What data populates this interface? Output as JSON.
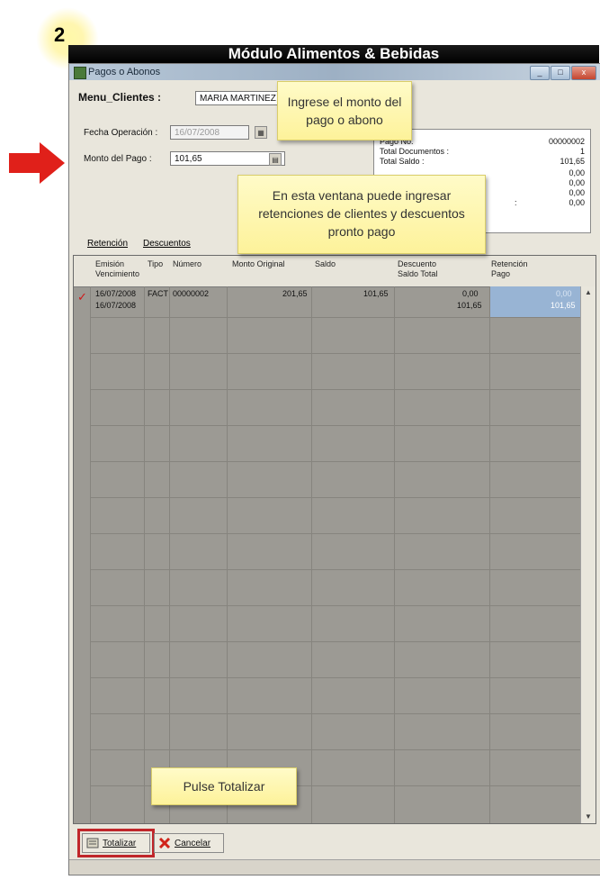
{
  "step_number": "2",
  "module_title": "Módulo Alimentos & Bebidas",
  "window": {
    "title": "Pagos o Abonos",
    "buttons": [
      "_",
      "□",
      "x"
    ]
  },
  "client": {
    "label": "Menu_Clientes :",
    "value": "MARIA MARTINEZ"
  },
  "form": {
    "fecha_label": "Fecha Operación :",
    "fecha_value": "16/07/2008",
    "monto_label": "Monto del Pago :",
    "monto_value": "101,65"
  },
  "summary": {
    "rows": [
      {
        "k": "Pago No.",
        "v": "00000002"
      },
      {
        "k": "Total Documentos :",
        "v": "1"
      },
      {
        "k": "Total Saldo :",
        "v": "101,65"
      },
      {
        "k": "",
        "v": "0,00"
      },
      {
        "k": "",
        "v": "0,00"
      },
      {
        "k": "",
        "v": "0,00"
      },
      {
        "k": ":",
        "v": "0,00"
      }
    ]
  },
  "tabs": [
    "Retención",
    "Descuentos"
  ],
  "grid": {
    "headers": [
      {
        "l1": "Emisión",
        "l2": "Vencimiento"
      },
      {
        "l1": "Tipo",
        "l2": ""
      },
      {
        "l1": "Número",
        "l2": ""
      },
      {
        "l1": "Monto Original",
        "l2": ""
      },
      {
        "l1": "Saldo",
        "l2": ""
      },
      {
        "l1": "Descuento",
        "l2": "Saldo Total"
      },
      {
        "l1": "Retención",
        "l2": "Pago"
      }
    ],
    "row": {
      "emision": "16/07/2008",
      "vencimiento": "16/07/2008",
      "tipo": "FACT",
      "numero": "00000002",
      "monto_original": "201,65",
      "saldo": "101,65",
      "descuento": "0,00",
      "saldo_total": "101,65",
      "retencion": "0,00",
      "pago": "101,65"
    }
  },
  "footer": {
    "totalizar": "Totalizar",
    "cancelar": "Cancelar"
  },
  "callouts": {
    "monto": "Ingrese el monto del pago o abono",
    "ventana": "En esta ventana puede ingresar retenciones de clientes y descuentos pronto pago",
    "totalizar": "Pulse Totalizar"
  },
  "colors": {
    "highlight": "#98b4d4",
    "callout": "#fdf29a",
    "arrow": "#e0201a",
    "outline": "#c0262a"
  }
}
